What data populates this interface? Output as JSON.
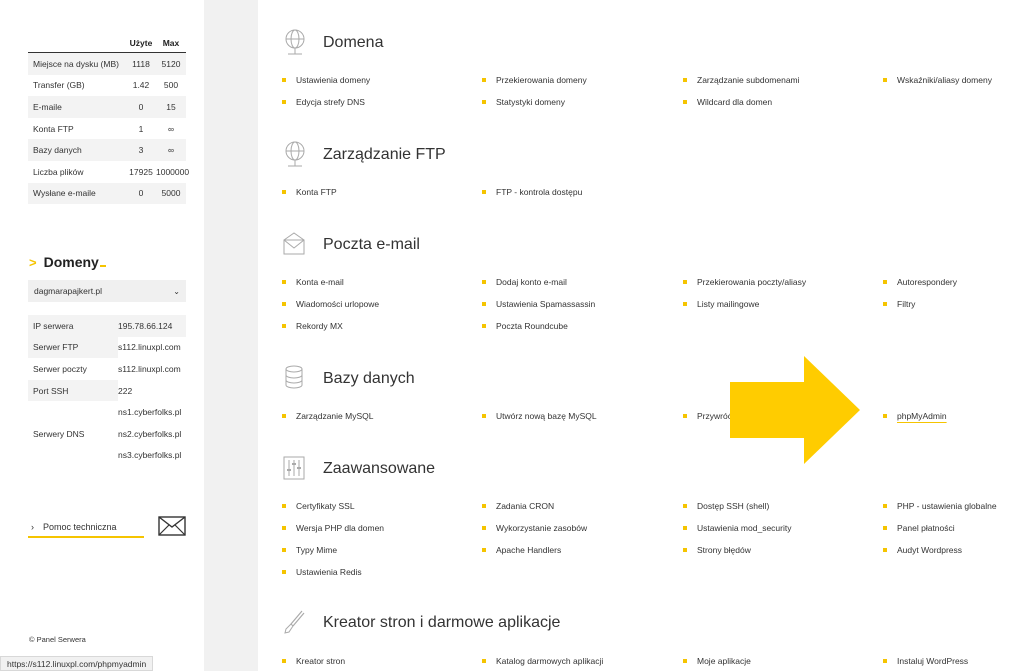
{
  "stats": {
    "header": {
      "used": "Użyte",
      "max": "Max"
    },
    "rows": [
      {
        "name": "Miejsce na dysku (MB)",
        "used": "1118",
        "max": "5120"
      },
      {
        "name": "Transfer (GB)",
        "used": "1.42",
        "max": "500"
      },
      {
        "name": "E-maile",
        "used": "0",
        "max": "15"
      },
      {
        "name": "Konta FTP",
        "used": "1",
        "max": "∞"
      },
      {
        "name": "Bazy danych",
        "used": "3",
        "max": "∞"
      },
      {
        "name": "Liczba plików",
        "used": "17925",
        "max": "1000000"
      },
      {
        "name": "Wysłane e-maile",
        "used": "0",
        "max": "5000"
      }
    ]
  },
  "domains": {
    "title": "Domeny",
    "selected": "dagmarapajkert.pl"
  },
  "server_info": [
    {
      "name": "IP serwera",
      "value": "195.78.66.124"
    },
    {
      "name": "Serwer FTP",
      "value": "s112.linuxpl.com"
    },
    {
      "name": "Serwer poczty",
      "value": "s112.linuxpl.com"
    },
    {
      "name": "Port SSH",
      "value": "222"
    },
    {
      "name": "",
      "value": "ns1.cyberfolks.pl"
    },
    {
      "name": "Serwery DNS",
      "value": "ns2.cyberfolks.pl"
    },
    {
      "name": "",
      "value": "ns3.cyberfolks.pl"
    }
  ],
  "help_label": "Pomoc techniczna",
  "copyright": "© Panel Serwera",
  "status_url": "https://s112.linuxpl.com/phpmyadmin",
  "sections": [
    {
      "title": "Domena",
      "icon": "globe-icon",
      "items": [
        "Ustawienia domeny",
        "Przekierowania domeny",
        "Zarządzanie subdomenami",
        "Wskaźniki/aliasy domeny",
        "Edycja strefy DNS",
        "Statystyki domeny",
        "Wildcard dla domen"
      ]
    },
    {
      "title": "Zarządzanie FTP",
      "icon": "globe-icon",
      "items": [
        "Konta FTP",
        "FTP - kontrola dostępu"
      ]
    },
    {
      "title": "Poczta e-mail",
      "icon": "envelope-open-icon",
      "items": [
        "Konta e-mail",
        "Dodaj konto e-mail",
        "Przekierowania poczty/aliasy",
        "Autorespondery",
        "Wiadomości urlopowe",
        "Ustawienia Spamassassin",
        "Listy mailingowe",
        "Filtry",
        "Rekordy MX",
        "Poczta Roundcube"
      ]
    },
    {
      "title": "Bazy danych",
      "icon": "database-icon",
      "items": [
        "Zarządzanie MySQL",
        "Utwórz nową bazę MySQL",
        "Przywróć",
        "phpMyAdmin"
      ]
    },
    {
      "title": "Zaawansowane",
      "icon": "sliders-icon",
      "items": [
        "Certyfikaty SSL",
        "Zadania CRON",
        "Dostęp SSH (shell)",
        "PHP - ustawienia globalne",
        "Wersja PHP dla domen",
        "Wykorzystanie zasobów",
        "Ustawienia mod_security",
        "Panel płatności",
        "Typy Mime",
        "Apache Handlers",
        "Strony błędów",
        "Audyt Wordpress",
        "Ustawienia Redis"
      ]
    },
    {
      "title": "Kreator stron i darmowe aplikacje",
      "icon": "brush-icon",
      "items": [
        "Kreator stron",
        "Katalog darmowych aplikacji",
        "Moje aplikacje",
        "Instaluj WordPress"
      ]
    }
  ],
  "colors": {
    "accent": "#f5c400",
    "arrow": "#ffcc00",
    "text": "#333333",
    "row_shade": "#f3f3f3"
  }
}
